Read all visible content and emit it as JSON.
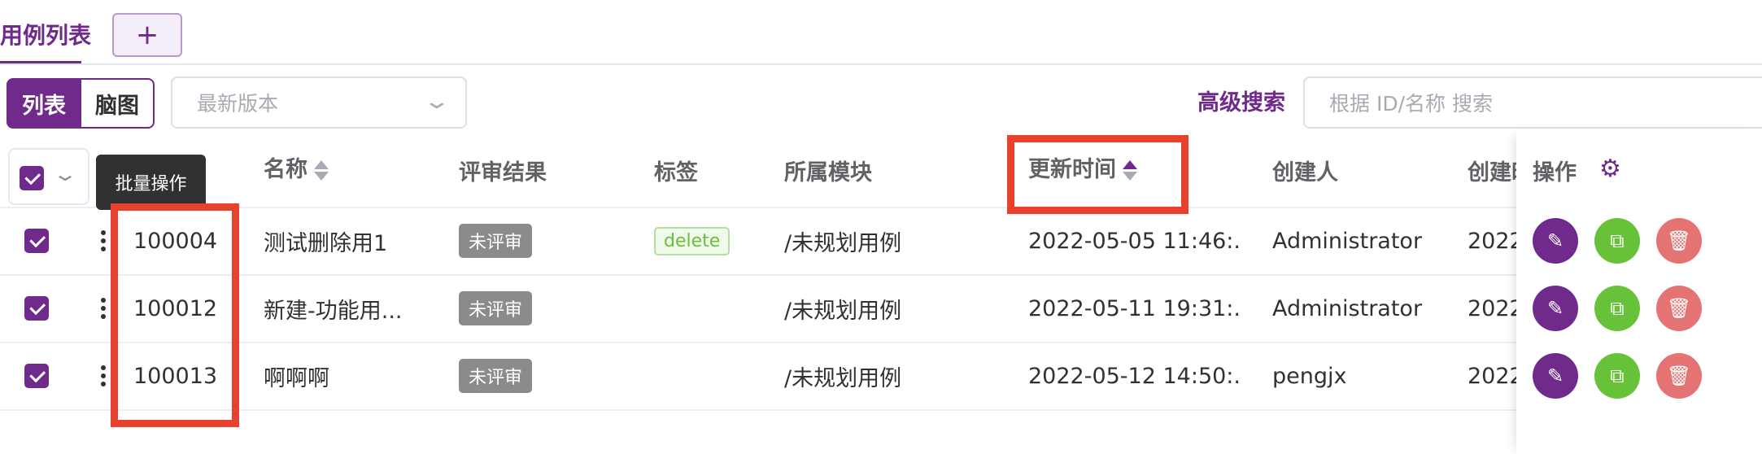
{
  "tabs": {
    "active": "用例列表",
    "add_symbol": "+"
  },
  "toolbar": {
    "view_list": "列表",
    "view_mind": "脑图",
    "version_placeholder": "最新版本",
    "advanced_search": "高级搜索",
    "search_placeholder": "根据 ID/名称 搜索"
  },
  "tooltip": "批量操作",
  "table": {
    "headers": {
      "name": "名称",
      "review": "评审结果",
      "tags": "标签",
      "module": "所属模块",
      "updated": "更新时间",
      "creator": "创建人",
      "created": "创建时间",
      "ops": "操作"
    },
    "rows": [
      {
        "id": "100004",
        "name": "测试删除用1",
        "review": "未评审",
        "tag": "delete",
        "module": "/未规划用例",
        "updated": "2022-05-05 11:46:...",
        "creator": "Administrator",
        "created": "2022"
      },
      {
        "id": "100012",
        "name": "新建-功能用...",
        "review": "未评审",
        "tag": "",
        "module": "/未规划用例",
        "updated": "2022-05-11 19:31:...",
        "creator": "Administrator",
        "created": "2022"
      },
      {
        "id": "100013",
        "name": "啊啊啊",
        "review": "未评审",
        "tag": "",
        "module": "/未规划用例",
        "updated": "2022-05-12 14:50:...",
        "creator": "pengjx",
        "created": "2022"
      }
    ]
  },
  "colors": {
    "primary": "#6f2a8c",
    "success": "#67c23a",
    "danger": "#e57373",
    "annotation": "#e8412e"
  },
  "icons": [
    "plus-icon",
    "chevron-down-icon",
    "sort-icon",
    "more-vertical-icon",
    "gear-icon",
    "edit-icon",
    "copy-icon",
    "delete-icon"
  ]
}
